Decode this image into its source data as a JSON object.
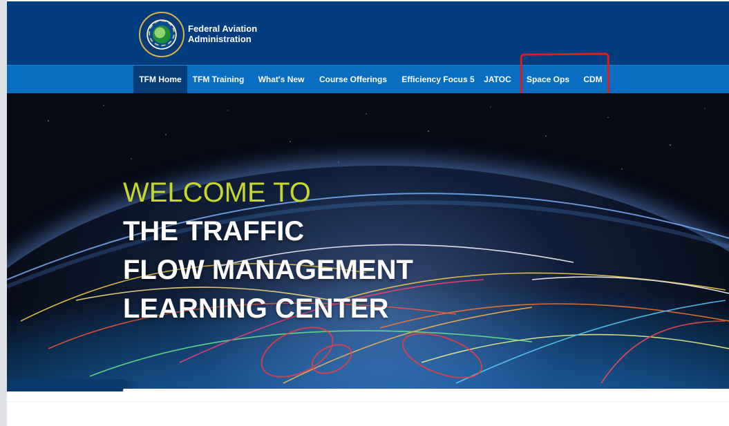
{
  "brand": {
    "name_line1": "Federal Aviation",
    "name_line2": "Administration"
  },
  "nav": {
    "items": [
      {
        "label": "TFM Home",
        "active": true
      },
      {
        "label": "TFM Training"
      },
      {
        "label": "What's New"
      },
      {
        "label": "Course Offerings"
      },
      {
        "label": "Efficiency Focus 5"
      },
      {
        "label": "JATOC"
      },
      {
        "label": "Space Ops"
      },
      {
        "label": "CDM"
      }
    ]
  },
  "hero": {
    "welcome": "WELCOME TO",
    "line1": "THE TRAFFIC",
    "line2": "FLOW MANAGEMENT",
    "line3": "LEARNING CENTER"
  },
  "colors": {
    "header_bg": "#003c7e",
    "nav_bg": "#0a6fc2",
    "nav_active_bg": "#073e79",
    "welcome_text": "#c6d82a",
    "annotation_box": "#e01b1b"
  },
  "icons": {
    "logo": "faa-seal-icon"
  }
}
